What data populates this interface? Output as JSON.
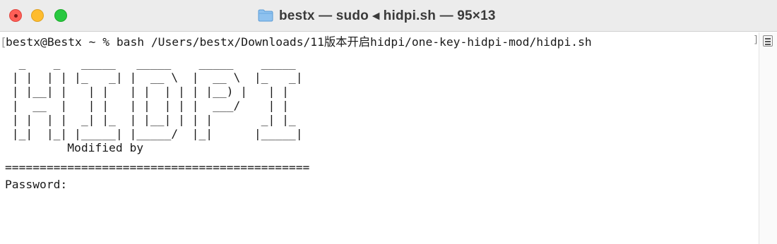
{
  "window": {
    "title": "bestx — sudo ◂ hidpi.sh — 95×13",
    "icon": "folder-icon"
  },
  "terminal": {
    "prompt_line": "bestx@Bestx ~ % bash /Users/bestx/Downloads/11版本开启hidpi/one-key-hidpi-mod/hidpi.sh",
    "open_bracket": "[",
    "ascii_banner": "  _    _   _____   _____    _____    _____\n | |  | | |_   _| |  __ \\  |  __ \\  |_   _|\n | |__| |   | |   | |  | | | |__) |   | |\n |  __  |   | |   | |  | | |  ___/    | |\n | |  | |  _| |_  | |__| | | |       _| |_\n |_|  |_| |_____| |_____/  |_|      |_____|\n         Modified by",
    "separator": "============================================",
    "password_prompt": "Password:"
  },
  "scrollbar": {
    "marker": "]"
  },
  "colors": {
    "close": "#fe5f57",
    "minimize": "#febc2e",
    "maximize": "#28c840",
    "titlebar": "#ececec",
    "text": "#1a1a1a"
  }
}
